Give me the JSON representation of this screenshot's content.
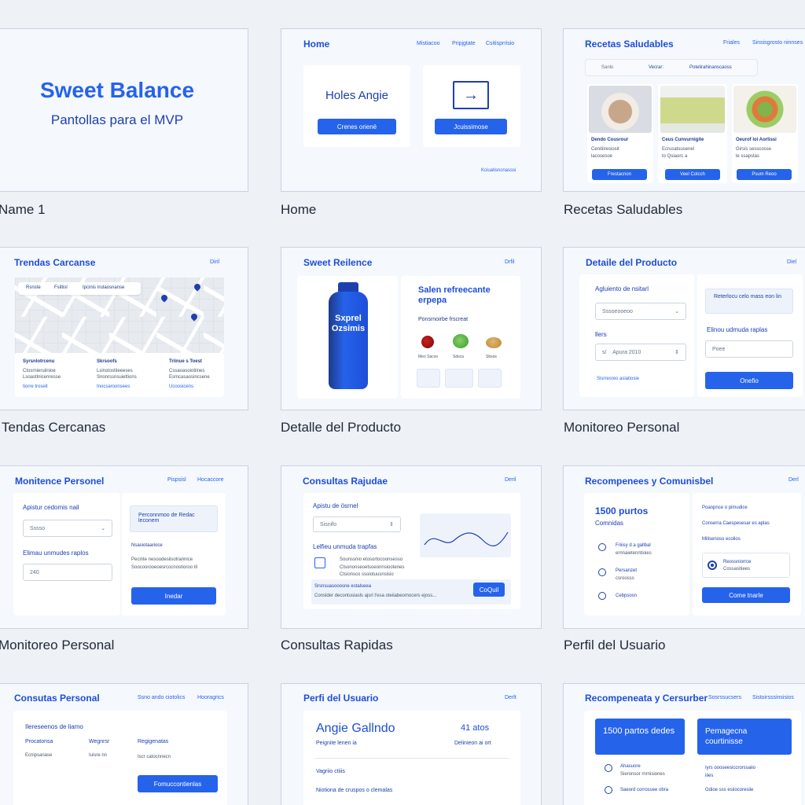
{
  "captions": [
    "Name 1",
    "Home",
    "Recetas Saludables",
    "Tendas Cercanas",
    "Detalle del Producto",
    "Monitoreo Personal",
    "Monitoreo Personal",
    "Consultas Rapidas",
    "Perfil del Usuario"
  ],
  "c1": {
    "title": "Sweet Balance",
    "subtitle": "Pantollas para el MVP"
  },
  "c2": {
    "header": "Home",
    "nav": [
      "Mistiacoo",
      "Pripjgtate",
      "Csitisprrisio"
    ],
    "greeting": "Holes Angie",
    "btn1": "Crenes orienë",
    "btn2": "Jcuissimose",
    "footer": "Kciuatisncnasssi"
  },
  "c3": {
    "header": "Recetas Saludables",
    "nav": [
      "Friales",
      "Sinsisgrosto ninnses"
    ],
    "tabs": [
      "Sanlo",
      "Vecrar:",
      "Potelirahinanscaoss"
    ],
    "items": [
      {
        "name": "Dendo Cousrour",
        "d1": "Cenitiiresiosit",
        "d2": "lacosesoe",
        "btn": "Frestacnon"
      },
      {
        "name": "Ceus Cunvurnigite",
        "d1": "Ecrusatsusenel",
        "d2": "to Qsiaorc a",
        "btn": "Veel Colcch"
      },
      {
        "name": "Oeurof loi Aorlissi",
        "d1": "Girsis sesscosse",
        "d2": "le ssapstas",
        "btn": "Psum Reoo"
      }
    ]
  },
  "c4": {
    "header": "Trendas Carcanse",
    "nav": "Diril",
    "chips": [
      "Rsnste",
      "Fsiltisl",
      "Ipcinis Irutaosnanse"
    ],
    "stores": [
      {
        "name": "Syrsnlotrcenu",
        "l1": "Ctosrnieruiinioe",
        "l2": "Lsoastlnicenresse",
        "l3": "tiorre troseit"
      },
      {
        "name": "Skrsoofs",
        "l1": "Lsinstostiieeeses",
        "l2": "Snonrssnsuiettions",
        "l3": "Inocsaroonsees"
      },
      {
        "name": "Triinue s Toest",
        "l1": "Cssaoasoiotiines",
        "l2": "Esmcasaosincsene",
        "l3": "Ucoosicens"
      }
    ]
  },
  "c5": {
    "header": "Sweet Reilence",
    "nav": "Drfil",
    "bottle": "Sxprel Ozsimis",
    "title": "Salen refreecante erpepa",
    "sub": "Ponsrnoirbe frscreat",
    "fruits": [
      "Meo Sacxo",
      "Sdsca",
      "Sbsos"
    ]
  },
  "c6": {
    "header": "Detaile del Producto",
    "nav": "Diel",
    "l1": "Agluiento de nsitarl",
    "inp1": "Sssoeooeoo",
    "l2": "llers",
    "inp2a": "s/",
    "inp2b": "Apura 2010",
    "link": "Sisrresreo asiatiosie",
    "r1": "Reterlocu celo mass eon lin",
    "r2": "Elinou udmuda raplas",
    "inp3": "Poee",
    "btn": "Onefio"
  },
  "c7": {
    "header": "Monitence Personel",
    "nav": [
      "Pispsisl",
      "Hocaccore"
    ],
    "l1": "Apistur cedomis nail",
    "inp1": "Sssso",
    "l2": "Elimau unmudes raplos",
    "inp2": "240",
    "r1": "Perconnmoo de Redac leconem",
    "r2": "Nsasiotaarioce",
    "r3": "Pecinte nesoodesiisotrannice",
    "r4": "Soocoorooeoesrcocnostioroo til",
    "btn": "Inedar"
  },
  "c8": {
    "header": "Consultas Rajudae",
    "nav": "Deril",
    "l1": "Apistu de ösrnel",
    "inp1": "Sisnifo",
    "l2": "Lelfieu unmuda trapfas",
    "e1": "Sounssnio etosortocoonsesso",
    "e2": "Ctsononseoetsoeonnsiootenes",
    "e3": "Ctsionsco ssoiotuusnsisio",
    "note1": "Srsnsuasooosne estalseea",
    "note2": "Conslder decontusiasls ajsri t'esa oteiiabeomocers ejoss...",
    "btn": "CoQuil"
  },
  "c9": {
    "header": "Recompenees y Comunisbel",
    "nav": "Derl",
    "pts": "1500 purtos",
    "pts2": "Comnidas",
    "a1": "Friiisy d a gallbal",
    "a1b": "ernnaietenntioies",
    "a2": "Persanzet",
    "a2b": "csroosss",
    "a3": "Cebpsosn",
    "r1": "Poanpnce o pimudice",
    "r2": "Conserra Caespesesar es aplas",
    "r3": "Milisenoso ecolios",
    "opt1": "Reossniorrce",
    "opt2": "Cossasitiees",
    "btn": "Come tnarle"
  },
  "c10": {
    "header": "Consutas Personal",
    "nav": [
      "Ssno ando ciotolics",
      "Hooragrics"
    ],
    "l1": "Ilereseenos de liamo",
    "cols": [
      [
        "Procatonsa",
        "Ecnipsanase"
      ],
      [
        "Wegnrsr",
        "Iuisre nn"
      ],
      [
        "Regigenatas",
        "Iscr catocnnecn"
      ]
    ],
    "btn": "Fomuccontienlas"
  },
  "c11": {
    "header": "Perfi del Usuario",
    "nav": "Derlt",
    "name": "Angie Gallndo",
    "sub": "Peignite lenen ia",
    "age": "41 atos",
    "age2": "Delinieon ai ort",
    "l1": "Vagriio ctiiis",
    "l2": "Niotiona de cruspos o clemalas"
  },
  "c12": {
    "header": "Recompeneata y Cersurber",
    "nav": [
      "Sosrssucsers",
      "Sistoirsssinsisios"
    ],
    "box1": "1500 partos dedes",
    "box2": "Pemagecna courtinisse",
    "a1": "Ahasuore",
    "a1b": "Sieronsor rnrnisiones",
    "a2": "Saeord corrossee obra",
    "r1": "Iyrs oooseesiccrorssaiio",
    "r1b": "iiies",
    "r2": "Gdioe sss esiiocoresiie"
  },
  "colors": {
    "accent": "#2563eb",
    "card": "#f5f8fd",
    "heading": "#1d4ed8"
  }
}
